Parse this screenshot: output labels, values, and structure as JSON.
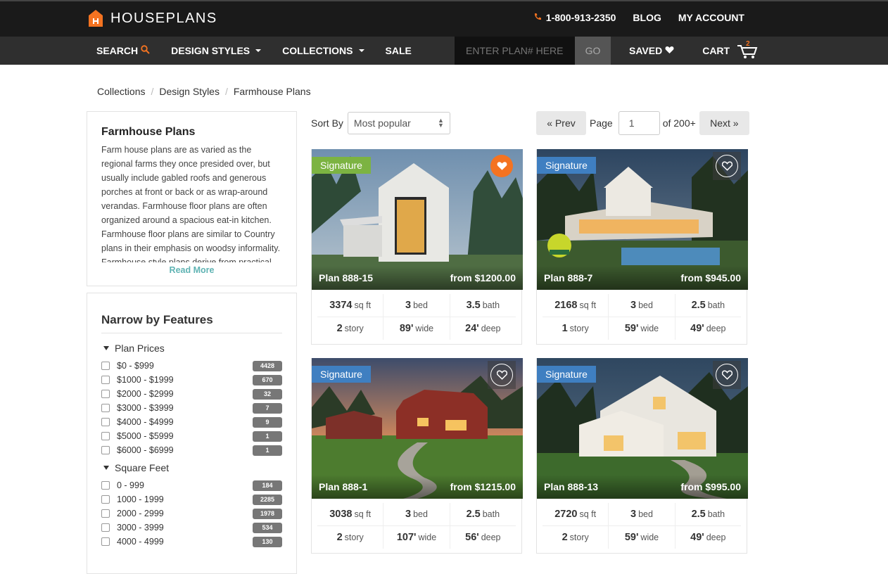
{
  "header": {
    "logo_text": "HOUSEPLANS",
    "phone": "1-800-913-2350",
    "blog": "BLOG",
    "account": "MY ACCOUNT"
  },
  "nav": {
    "search": "SEARCH",
    "design_styles": "DESIGN STYLES",
    "collections": "COLLECTIONS",
    "sale": "SALE",
    "plan_placeholder": "ENTER PLAN# HERE",
    "go": "GO",
    "saved": "SAVED",
    "cart": "CART",
    "cart_count": "2"
  },
  "breadcrumb": [
    "Collections",
    "Design Styles",
    "Farmhouse Plans"
  ],
  "about": {
    "title": "Farmhouse Plans",
    "text": "Farm house plans are as varied as the regional farms they once presided over, but usually include gabled roofs and generous porches at front or back or as wrap-around verandas. Farmhouse floor plans are often organized around a spacious eat-in kitchen. Farmhouse floor plans are similar to Country plans in their emphasis on woodsy informality. Farmhouse style plans derive from practical,",
    "read_more": "Read More"
  },
  "filters": {
    "title": "Narrow by Features",
    "groups": [
      {
        "title": "Plan Prices",
        "options": [
          {
            "label": "$0 - $999",
            "count": "4428"
          },
          {
            "label": "$1000 - $1999",
            "count": "670"
          },
          {
            "label": "$2000 - $2999",
            "count": "32"
          },
          {
            "label": "$3000 - $3999",
            "count": "7"
          },
          {
            "label": "$4000 - $4999",
            "count": "9"
          },
          {
            "label": "$5000 - $5999",
            "count": "1"
          },
          {
            "label": "$6000 - $6999",
            "count": "1"
          }
        ]
      },
      {
        "title": "Square Feet",
        "options": [
          {
            "label": "0 - 999",
            "count": "184"
          },
          {
            "label": "1000 - 1999",
            "count": "2285"
          },
          {
            "label": "2000 - 2999",
            "count": "1978"
          },
          {
            "label": "3000 - 3999",
            "count": "534"
          },
          {
            "label": "4000 - 4999",
            "count": "130"
          }
        ]
      }
    ]
  },
  "sort": {
    "label": "Sort By",
    "value": "Most popular"
  },
  "pager": {
    "prev": "« Prev",
    "page_label": "Page",
    "page_value": "1",
    "of_label": "of 200+",
    "next": "Next »"
  },
  "plans": [
    {
      "badge": "Signature",
      "name": "Plan 888-15",
      "price": "from $1200.00",
      "sqft": "3374",
      "sqft_unit": "sq ft",
      "bed": "3",
      "bed_unit": "bed",
      "bath": "3.5",
      "bath_unit": "bath",
      "story": "2",
      "story_unit": "story",
      "wide": "89'",
      "wide_unit": "wide",
      "deep": "24'",
      "deep_unit": "deep",
      "saved": true,
      "badge_color": "#7cb342"
    },
    {
      "badge": "Signature",
      "name": "Plan 888-7",
      "price": "from $945.00",
      "sqft": "2168",
      "sqft_unit": "sq ft",
      "bed": "3",
      "bed_unit": "bed",
      "bath": "2.5",
      "bath_unit": "bath",
      "story": "1",
      "story_unit": "story",
      "wide": "59'",
      "wide_unit": "wide",
      "deep": "49'",
      "deep_unit": "deep",
      "saved": false,
      "badge_color": "#3f7fc1"
    },
    {
      "badge": "Signature",
      "name": "Plan 888-1",
      "price": "from $1215.00",
      "sqft": "3038",
      "sqft_unit": "sq ft",
      "bed": "3",
      "bed_unit": "bed",
      "bath": "2.5",
      "bath_unit": "bath",
      "story": "2",
      "story_unit": "story",
      "wide": "107'",
      "wide_unit": "wide",
      "deep": "56'",
      "deep_unit": "deep",
      "saved": false,
      "badge_color": "#3f7fc1"
    },
    {
      "badge": "Signature",
      "name": "Plan 888-13",
      "price": "from $995.00",
      "sqft": "2720",
      "sqft_unit": "sq ft",
      "bed": "3",
      "bed_unit": "bed",
      "bath": "2.5",
      "bath_unit": "bath",
      "story": "2",
      "story_unit": "story",
      "wide": "59'",
      "wide_unit": "wide",
      "deep": "49'",
      "deep_unit": "deep",
      "saved": false,
      "badge_color": "#3f7fc1"
    }
  ],
  "colors": {
    "accent_orange": "#f47321",
    "topbar": "#1a1a1a",
    "navbar": "#2f2f2f",
    "read_more": "#5fb3b3"
  }
}
